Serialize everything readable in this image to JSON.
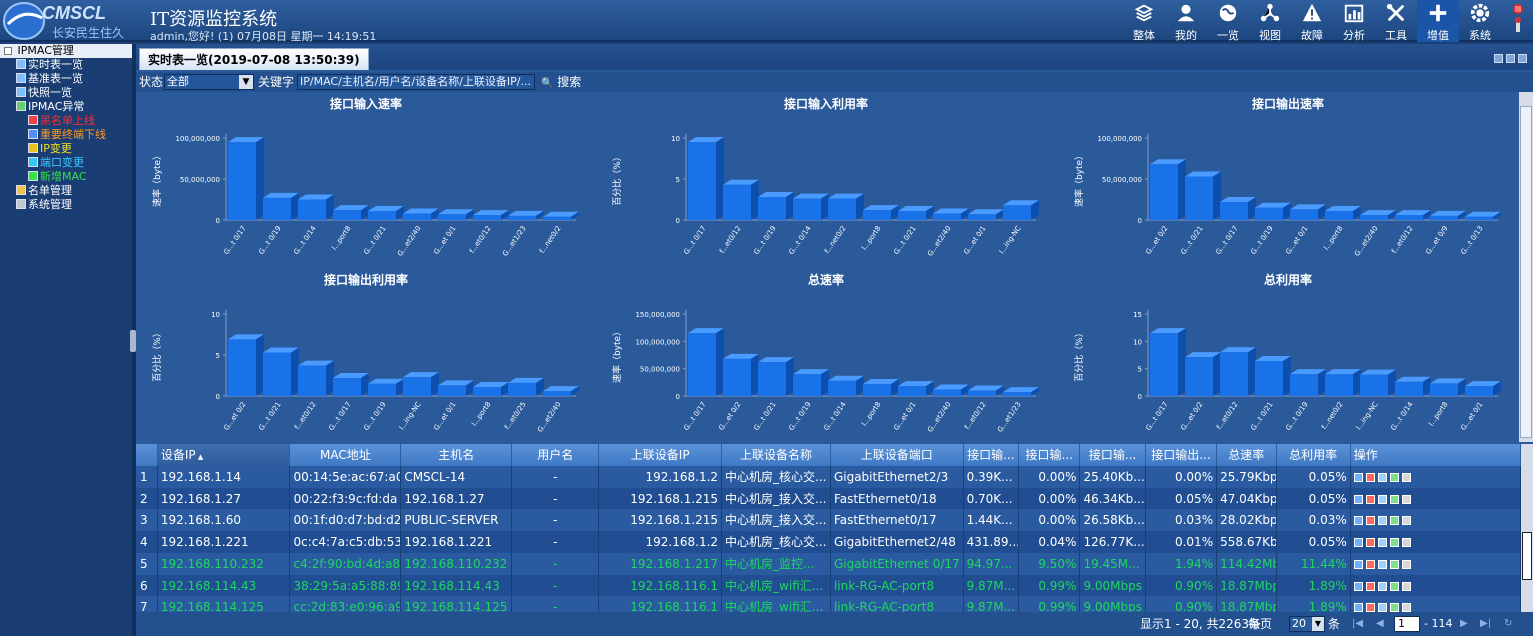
{
  "header": {
    "logo_text": "CMSCL",
    "logo_subtext": "长安民生住久",
    "title": "IT资源监控系统",
    "user_info": "admin,您好! (1) 07月08日 星期一 14:19:51",
    "nav": [
      {
        "label": "整体",
        "icon": "layers-icon"
      },
      {
        "label": "我的",
        "icon": "user-icon"
      },
      {
        "label": "一览",
        "icon": "globe-icon"
      },
      {
        "label": "视图",
        "icon": "network-icon"
      },
      {
        "label": "故障",
        "icon": "warning-icon"
      },
      {
        "label": "分析",
        "icon": "chart-icon"
      },
      {
        "label": "工具",
        "icon": "tools-icon"
      },
      {
        "label": "增值",
        "icon": "plus-icon"
      },
      {
        "label": "系统",
        "icon": "gear-icon"
      }
    ]
  },
  "sidebar": {
    "root": "IPMAC管理",
    "items": [
      {
        "label": "实时表一览",
        "color": "#ffffff",
        "level": 1
      },
      {
        "label": "基准表一览",
        "color": "#ffffff",
        "level": 1
      },
      {
        "label": "快照一览",
        "color": "#ffffff",
        "level": 1
      },
      {
        "label": "IPMAC异常",
        "color": "#ffffff",
        "level": 1
      },
      {
        "label": "黑名单上线",
        "color": "#ff2a2a",
        "level": 2
      },
      {
        "label": "重要终端下线",
        "color": "#ff9a1f",
        "level": 2
      },
      {
        "label": "IP变更",
        "color": "#f0e02a",
        "level": 2
      },
      {
        "label": "端口变更",
        "color": "#35c8ff",
        "level": 2
      },
      {
        "label": "新增MAC",
        "color": "#38e04a",
        "level": 2
      },
      {
        "label": "名单管理",
        "color": "#ffffff",
        "level": 1
      },
      {
        "label": "系统管理",
        "color": "#ffffff",
        "level": 1
      }
    ]
  },
  "tab": {
    "active_label": "实时表一览(2019-07-08 13:50:39)"
  },
  "filter": {
    "status_label": "状态",
    "status_value": "全部",
    "keyword_label": "关键字",
    "keyword_placeholder": "IP/MAC/主机名/用户名/设备名称/上联设备IP/...",
    "search_label": "搜索"
  },
  "chart_data": [
    {
      "type": "bar",
      "title": "接口输入速率",
      "ylabel": "速率（byte）",
      "ylim": [
        0,
        100000000
      ],
      "yticks": [
        "100,000,000",
        "50,000,000",
        "0"
      ],
      "categories": [
        "G...t 0/17",
        "G...t 0/19",
        "G...t 0/14",
        "l...port8",
        "G...t 0/21",
        "G...et2/40",
        "G...et 0/1",
        "f...et0/12",
        "G...et1/23",
        "f...net0/2"
      ],
      "values": [
        95000000,
        27000000,
        25000000,
        12000000,
        11000000,
        8000000,
        7000000,
        6000000,
        5000000,
        4000000
      ]
    },
    {
      "type": "bar",
      "title": "接口输入利用率",
      "ylabel": "百分比（%）",
      "ylim": [
        0,
        10
      ],
      "yticks": [
        "10",
        "5",
        "0"
      ],
      "categories": [
        "G...t 0/17",
        "f...et0/12",
        "G...t 0/19",
        "G...t 0/14",
        "f...net0/2",
        "l...port8",
        "G...t 0/21",
        "G...et2/40",
        "G...et 0/1",
        "l...ing-NC"
      ],
      "values": [
        9.5,
        4.3,
        2.8,
        2.6,
        2.6,
        1.2,
        1.1,
        0.8,
        0.7,
        1.8
      ]
    },
    {
      "type": "bar",
      "title": "接口输出速率",
      "ylabel": "速率（byte）",
      "ylim": [
        0,
        100000000
      ],
      "yticks": [
        "100,000,000",
        "50,000,000",
        "0"
      ],
      "categories": [
        "G...et 0/2",
        "G...t 0/21",
        "G...t 0/17",
        "G...t 0/19",
        "G...et 0/1",
        "l...port8",
        "G...et2/40",
        "f...et0/12",
        "G...et 0/9",
        "G...t 0/13"
      ],
      "values": [
        68000000,
        53000000,
        22000000,
        15000000,
        13000000,
        11000000,
        6000000,
        6000000,
        5000000,
        4000000
      ]
    },
    {
      "type": "bar",
      "title": "接口输出利用率",
      "ylabel": "百分比（%）",
      "ylim": [
        0,
        10
      ],
      "yticks": [
        "10",
        "5",
        "0"
      ],
      "categories": [
        "G...et 0/2",
        "G...t 0/21",
        "f...et0/12",
        "G...t 0/17",
        "G...t 0/19",
        "l...ing-NC",
        "G...et 0/1",
        "l...port8",
        "f...et0/25",
        "G...et2/40"
      ],
      "values": [
        6.9,
        5.3,
        3.7,
        2.2,
        1.5,
        2.3,
        1.3,
        1.1,
        1.6,
        0.6
      ]
    },
    {
      "type": "bar",
      "title": "总速率",
      "ylabel": "速率（byte）",
      "ylim": [
        0,
        150000000
      ],
      "yticks": [
        "150,000,000",
        "100,000,000",
        "50,000,000",
        "0"
      ],
      "categories": [
        "G...t 0/17",
        "G...et 0/2",
        "G...t 0/21",
        "G...t 0/19",
        "G...t 0/14",
        "l...port8",
        "G...et 0/1",
        "G...et2/40",
        "f...et0/12",
        "G...et1/23"
      ],
      "values": [
        115000000,
        68000000,
        62000000,
        40000000,
        28000000,
        22000000,
        18000000,
        12000000,
        10000000,
        7000000
      ]
    },
    {
      "type": "bar",
      "title": "总利用率",
      "ylabel": "百分比（%）",
      "ylim": [
        0,
        15
      ],
      "yticks": [
        "15",
        "10",
        "5",
        "0"
      ],
      "categories": [
        "G...t 0/17",
        "G...et 0/2",
        "f...et0/12",
        "G...t 0/21",
        "G...t 0/19",
        "f...net0/2",
        "l...ing-NC",
        "G...t 0/14",
        "l...port8",
        "G...et 0/1"
      ],
      "values": [
        11.5,
        7.1,
        8.0,
        6.4,
        4.0,
        4.0,
        3.9,
        2.6,
        2.3,
        1.8
      ]
    }
  ],
  "table": {
    "columns": [
      "设备IP",
      "MAC地址",
      "主机名",
      "用户名",
      "上联设备IP",
      "上联设备名称",
      "上联设备端口",
      "接口输...",
      "接口输...",
      "接口输...",
      "接口输出...",
      "总速率",
      "总利用率",
      "操作"
    ],
    "sort_indicator": "▲",
    "rows": [
      {
        "n": "1",
        "ip": "192.168.1.14",
        "mac": "00:14:5e:ac:67:a0",
        "host": "CMSCL-14",
        "user": "-",
        "up_ip": "192.168.1.2",
        "up_name": "中心机房_核心交...",
        "up_port": "GigabitEthernet2/3",
        "in_rate": "0.39K...",
        "in_util": "0.00%",
        "out_rate": "25.40Kb...",
        "out_util": "0.00%",
        "total_rate": "25.79Kbps",
        "total_util": "0.05%",
        "green": false
      },
      {
        "n": "2",
        "ip": "192.168.1.27",
        "mac": "00:22:f3:9c:fd:da",
        "host": "192.168.1.27",
        "user": "-",
        "up_ip": "192.168.1.215",
        "up_name": "中心机房_接入交...",
        "up_port": "FastEthernet0/18",
        "in_rate": "0.70K...",
        "in_util": "0.00%",
        "out_rate": "46.34Kb...",
        "out_util": "0.05%",
        "total_rate": "47.04Kbps",
        "total_util": "0.05%",
        "green": false
      },
      {
        "n": "3",
        "ip": "192.168.1.60",
        "mac": "00:1f:d0:d7:bd:d2",
        "host": "PUBLIC-SERVER",
        "user": "-",
        "up_ip": "192.168.1.215",
        "up_name": "中心机房_接入交...",
        "up_port": "FastEthernet0/17",
        "in_rate": "1.44K...",
        "in_util": "0.00%",
        "out_rate": "26.58Kb...",
        "out_util": "0.03%",
        "total_rate": "28.02Kbps",
        "total_util": "0.03%",
        "green": false
      },
      {
        "n": "4",
        "ip": "192.168.1.221",
        "mac": "0c:c4:7a:c5:db:53",
        "host": "192.168.1.221",
        "user": "-",
        "up_ip": "192.168.1.2",
        "up_name": "中心机房_核心交...",
        "up_port": "GigabitEthernet2/48",
        "in_rate": "431.89...",
        "in_util": "0.04%",
        "out_rate": "126.77K...",
        "out_util": "0.01%",
        "total_rate": "558.67Kbps",
        "total_util": "0.05%",
        "green": false
      },
      {
        "n": "5",
        "ip": "192.168.110.232",
        "mac": "c4:2f:90:bd:4d:a8",
        "host": "192.168.110.232",
        "user": "-",
        "up_ip": "192.168.1.217",
        "up_name": "中心机房_监控...",
        "up_port": "GigabitEthernet 0/17",
        "in_rate": "94.97...",
        "in_util": "9.50%",
        "out_rate": "19.45M...",
        "out_util": "1.94%",
        "total_rate": "114.42Mbps",
        "total_util": "11.44%",
        "green": true
      },
      {
        "n": "6",
        "ip": "192.168.114.43",
        "mac": "38:29:5a:a5:88:89",
        "host": "192.168.114.43",
        "user": "-",
        "up_ip": "192.168.116.1",
        "up_name": "中心机房_wifi汇...",
        "up_port": "link-RG-AC-port8",
        "in_rate": "9.87M...",
        "in_util": "0.99%",
        "out_rate": "9.00Mbps",
        "out_util": "0.90%",
        "total_rate": "18.87Mbps",
        "total_util": "1.89%",
        "green": true
      },
      {
        "n": "7",
        "ip": "192.168.114.125",
        "mac": "cc:2d:83:e0:96:a9",
        "host": "192.168.114.125",
        "user": "-",
        "up_ip": "192.168.116.1",
        "up_name": "中心机房_wifi汇...",
        "up_port": "link-RG-AC-port8",
        "in_rate": "9.87M...",
        "in_util": "0.99%",
        "out_rate": "9.00Mbps",
        "out_util": "0.90%",
        "total_rate": "18.87Mbps",
        "total_util": "1.89%",
        "green": true
      }
    ],
    "op_icon_colors": [
      "#6fb0ff",
      "#ff6a5a",
      "#9fd0ff",
      "#7ee08a",
      "#d8d8d8"
    ]
  },
  "pager": {
    "info": "显示1 - 20, 共2263条",
    "per_page_label": "每页",
    "per_page_value": "20",
    "unit_label": "条",
    "page_value": "1",
    "total_pages": "- 114"
  }
}
